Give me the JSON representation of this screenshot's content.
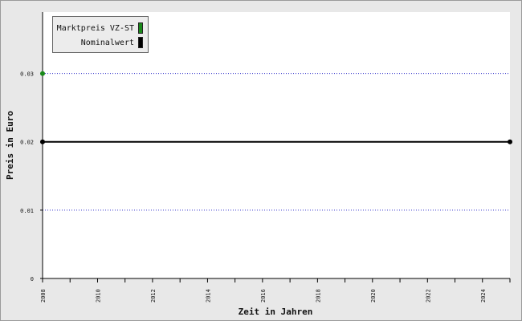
{
  "chart_data": {
    "type": "line",
    "title": "",
    "xlabel": "Zeit in Jahren",
    "ylabel": "Preis in Euro",
    "xlim": [
      2008,
      2025
    ],
    "ylim": [
      0,
      0.039
    ],
    "x_ticks": [
      2008,
      2010,
      2012,
      2014,
      2016,
      2018,
      2020,
      2022,
      2024
    ],
    "x_tick_labels": [
      "2008",
      "2010",
      "2012",
      "2014",
      "2016",
      "2018",
      "2020",
      "2022",
      "2024"
    ],
    "y_ticks": [
      0,
      0.01,
      0.02,
      0.03
    ],
    "y_tick_labels": [
      "0",
      "0.01",
      "0.02",
      "0.03"
    ],
    "grid": "horizontal dotted",
    "legend_position": "top-left",
    "series": [
      {
        "name": "Marktpreis VZ-ST",
        "color": "#1a8a1a",
        "points": [
          [
            2008,
            0.03
          ]
        ]
      },
      {
        "name": "Nominalwert",
        "color": "#000000",
        "points": [
          [
            2008,
            0.02
          ],
          [
            2025,
            0.02
          ]
        ]
      }
    ]
  },
  "colors": {
    "background": "#e8e8e8",
    "plot_background": "#ffffff",
    "grid": "#3333cc"
  }
}
